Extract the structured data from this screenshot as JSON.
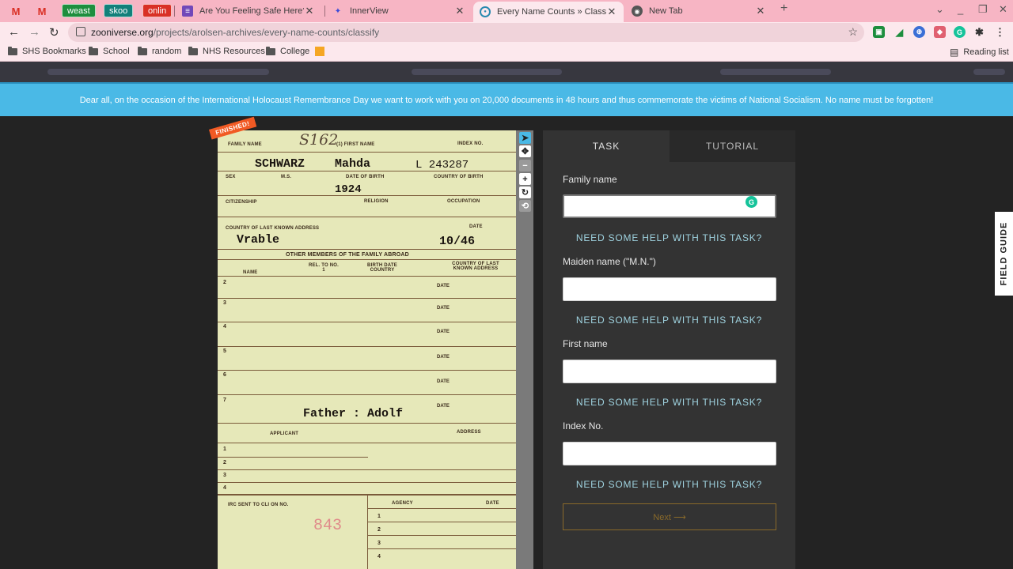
{
  "browser": {
    "pinned": [
      {
        "label": "M"
      },
      {
        "label": "M"
      },
      {
        "label": "weast",
        "color": "#1e8e3e"
      },
      {
        "label": "skoo",
        "color": "#12807a"
      },
      {
        "label": "onlin",
        "color": "#d93025"
      }
    ],
    "tabs": [
      {
        "title": "Are You Feeling Safe Here? - Goo",
        "icon": "forms-icon"
      },
      {
        "title": "InnerView",
        "icon": "innerview-icon"
      },
      {
        "title": "Every Name Counts » Classify —",
        "icon": "zooniverse-icon",
        "active": true
      },
      {
        "title": "New Tab",
        "icon": "chrome-icon"
      }
    ],
    "url_host": "zooniverse.org",
    "url_path": "/projects/arolsen-archives/every-name-counts/classify",
    "bookmarks": [
      "SHS Bookmarks",
      "School",
      "random",
      "NHS Resources",
      "College"
    ],
    "reading_list": "Reading list"
  },
  "banner": "Dear all, on the occasion of the International Holocaust Remembrance Day we want to work with you on 20,000 documents in 48 hours and thus commemorate the victims of National Socialism. No name must be forgotten!",
  "document": {
    "ribbon": "FINISHED!",
    "labels": {
      "family_name": "FAMILY NAME",
      "first_name": "(1) FIRST NAME",
      "index_no": "INDEX NO.",
      "sex": "SEX",
      "ms": "M.S.",
      "dob": "DATE OF BIRTH",
      "cob": "COUNTRY OF BIRTH",
      "citizenship": "CITIZENSHIP",
      "religion": "RELIGION",
      "occupation": "OCCUPATION",
      "last_address": "COUNTRY OF LAST KNOWN ADDRESS",
      "date": "DATE",
      "other_members": "OTHER MEMBERS OF THE FAMILY ABROAD",
      "name": "NAME",
      "rel": "REL. TO NO. 1",
      "birth": "BIRTH DATE COUNTRY",
      "last_known": "COUNTRY OF LAST KNOWN ADDRESS",
      "applicant": "APPLICANT",
      "address": "ADDRESS",
      "irc": "IRC SENT TO CLI ON NO.",
      "agency": "AGENCY"
    },
    "values": {
      "handwritten_code": "S162",
      "family_name": "SCHWARZ",
      "first_name": "Mahda",
      "index": "L 243287",
      "year": "1924",
      "country": "Vrable",
      "date": "10/46",
      "father": "Father : Adolf",
      "irc_number": "843"
    },
    "row_numbers": [
      "2",
      "3",
      "4",
      "5",
      "6",
      "7"
    ],
    "applicant_rows": [
      "1",
      "2",
      "3",
      "4"
    ],
    "agency_rows": [
      "1",
      "2",
      "3",
      "4"
    ]
  },
  "tools": [
    "pointer-icon",
    "move-icon",
    "zoom-out-icon",
    "zoom-in-icon",
    "rotate-icon",
    "reset-icon"
  ],
  "panel": {
    "tab_task": "TASK",
    "tab_tutorial": "TUTORIAL",
    "fields": [
      {
        "label": "Family name",
        "value": ""
      },
      {
        "label": "Maiden name (\"M.N.\")",
        "value": ""
      },
      {
        "label": "First name",
        "value": ""
      },
      {
        "label": "Index No.",
        "value": ""
      }
    ],
    "help": "NEED SOME HELP WITH THIS TASK?",
    "next": "Next ⟶"
  },
  "field_guide": "FIELD GUIDE"
}
